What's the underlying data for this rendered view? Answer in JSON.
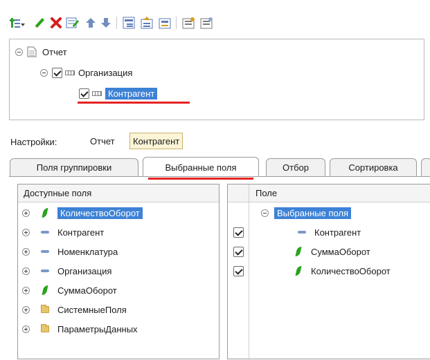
{
  "toolbar": {
    "buttons": [
      {
        "name": "add-group-icon",
        "color": "#2f9e2f"
      },
      {
        "name": "edit-icon",
        "color": "#2aa31d"
      },
      {
        "name": "delete-icon",
        "color": "#d62020"
      },
      {
        "name": "edit-list-icon",
        "color": "#5a78b5"
      },
      {
        "name": "move-up-icon",
        "color": "#6f8fbf"
      },
      {
        "name": "move-down-icon",
        "color": "#6f8fbf"
      },
      {
        "name": "group-icon",
        "color": "#5a78b5"
      },
      {
        "name": "group-up-icon",
        "color": "#d4a020"
      },
      {
        "name": "ungroup-icon",
        "color": "#5a78b5"
      },
      {
        "name": "settings-icon",
        "color": "#7a7a7a"
      },
      {
        "name": "settings-alt-icon",
        "color": "#7a7a7a"
      }
    ]
  },
  "tree": {
    "root": "Отчет",
    "group": "Организация",
    "selected": "Контрагент"
  },
  "settings": {
    "label": "Настройки:",
    "crumbs": [
      "Отчет",
      "Контрагент"
    ]
  },
  "tabs": [
    "Поля группировки",
    "Выбранные поля",
    "Отбор",
    "Сортировка"
  ],
  "active_tab": 1,
  "available": {
    "header": "Доступные поля",
    "items": [
      "КоличествоОборот",
      "Контрагент",
      "Номенклатура",
      "Организация",
      "СуммаОборот",
      "СистемныеПоля",
      "ПараметрыДанных"
    ]
  },
  "selected_fields": {
    "header": "Поле",
    "group": "Выбранные поля",
    "items": [
      "Контрагент",
      "СуммаОборот",
      "КоличествоОборот"
    ]
  },
  "colors": {
    "selection": "#3d82d6",
    "underline": "#e52222"
  }
}
